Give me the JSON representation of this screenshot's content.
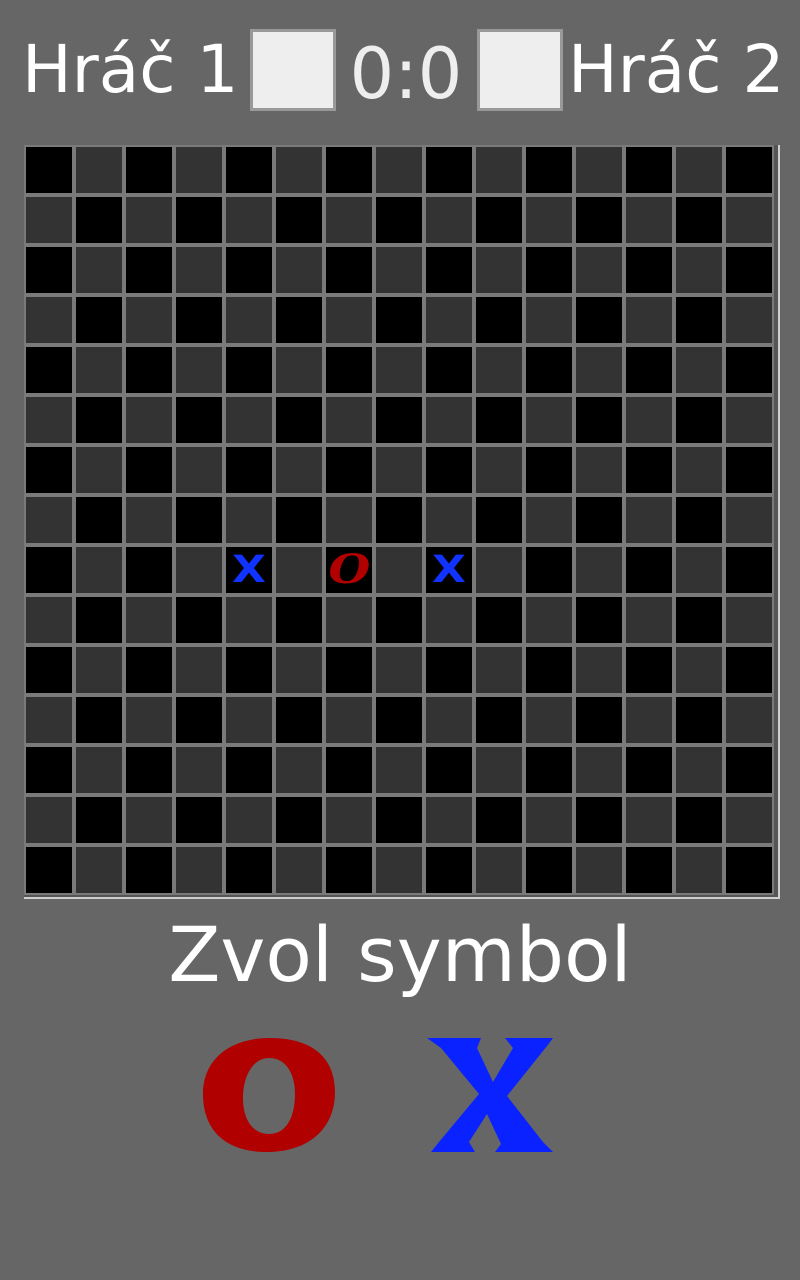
{
  "header": {
    "player1": "Hráč 1",
    "player2": "Hráč 2",
    "score": "0:0"
  },
  "board": {
    "size": 15,
    "marks": [
      {
        "row": 8,
        "col": 4,
        "symbol": "X"
      },
      {
        "row": 8,
        "col": 6,
        "symbol": "O"
      },
      {
        "row": 8,
        "col": 8,
        "symbol": "X"
      }
    ]
  },
  "prompt": "Zvol symbol",
  "symbols": {
    "o_icon": "red-o-icon",
    "x_icon": "blue-x-icon",
    "o_color": "#b00000",
    "x_color": "#1133ff"
  },
  "colors": {
    "background": "#666666",
    "cell_dark": "#000000",
    "cell_light": "#333333"
  }
}
